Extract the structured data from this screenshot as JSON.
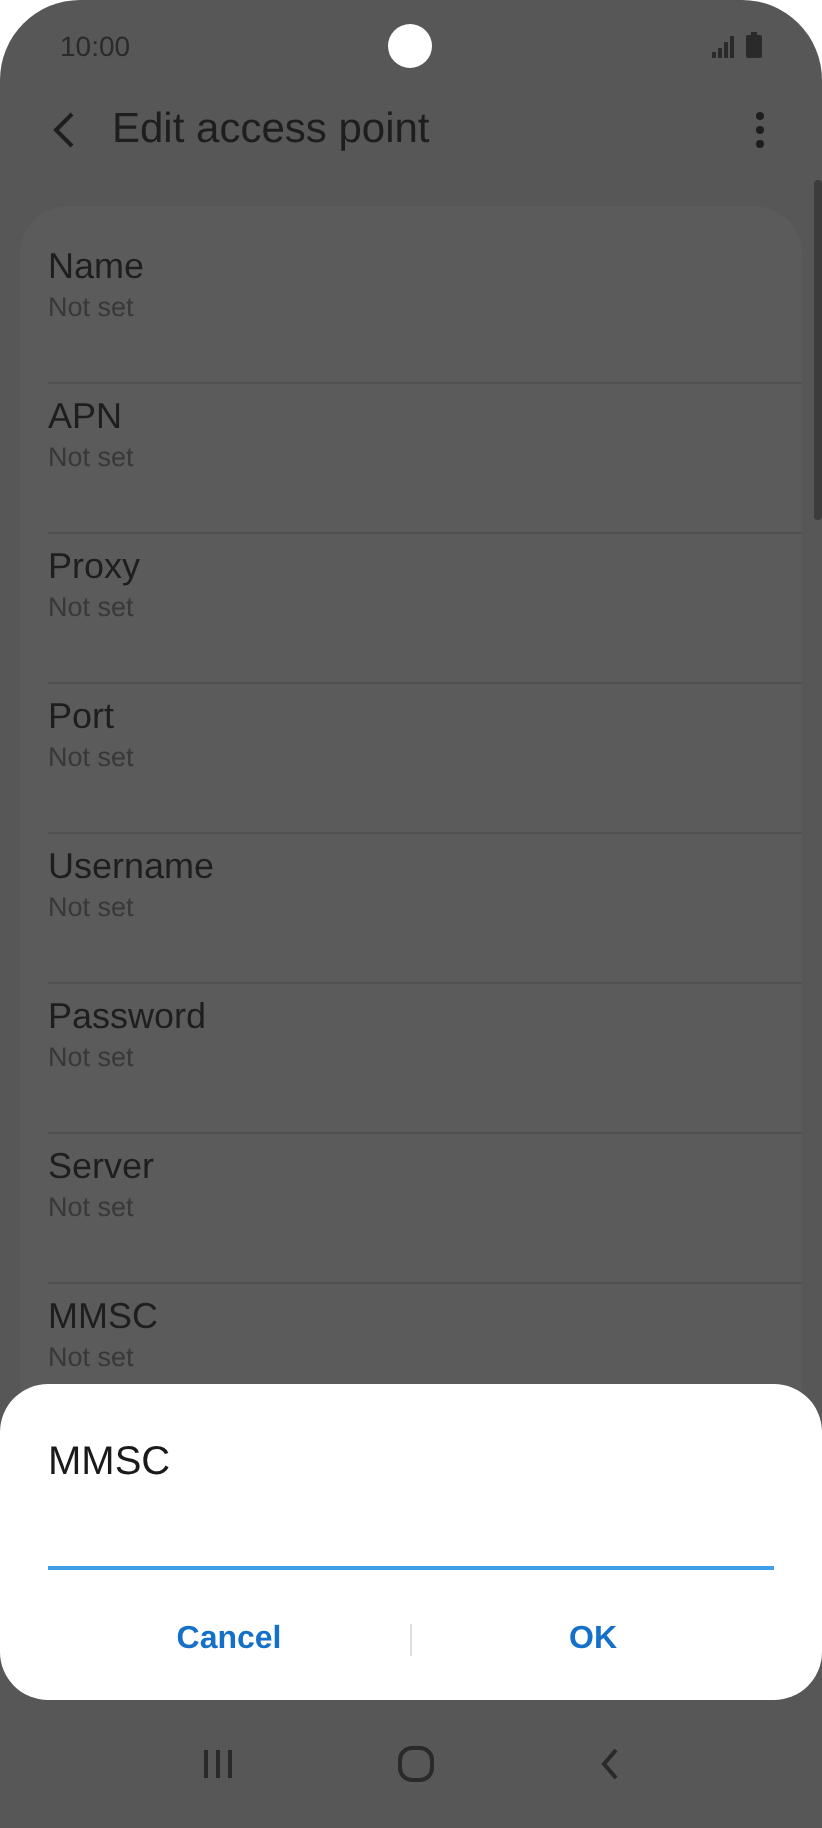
{
  "status_bar": {
    "time": "10:00"
  },
  "app_bar": {
    "title": "Edit access point"
  },
  "settings": [
    {
      "label": "Name",
      "value": "Not set"
    },
    {
      "label": "APN",
      "value": "Not set"
    },
    {
      "label": "Proxy",
      "value": "Not set"
    },
    {
      "label": "Port",
      "value": "Not set"
    },
    {
      "label": "Username",
      "value": "Not set"
    },
    {
      "label": "Password",
      "value": "Not set"
    },
    {
      "label": "Server",
      "value": "Not set"
    },
    {
      "label": "MMSC",
      "value": "Not set"
    }
  ],
  "dialog": {
    "title": "MMSC",
    "buttons": [
      "Cancel",
      "OK"
    ]
  }
}
